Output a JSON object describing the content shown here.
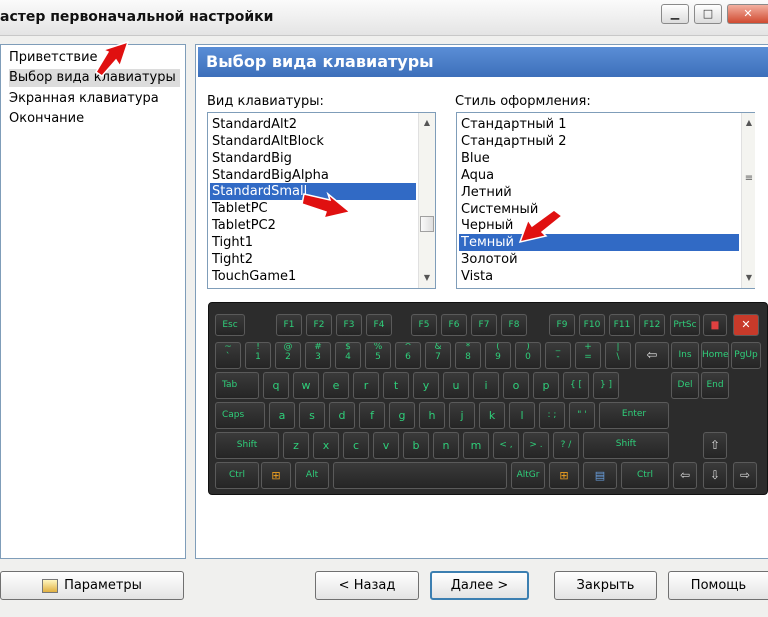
{
  "window": {
    "title": "астер первоначальной настройки",
    "buttons": {
      "minimize": "▁",
      "maximize": "□",
      "close": "✕"
    }
  },
  "nav": {
    "items": [
      {
        "label": "Приветствие"
      },
      {
        "label": "Выбор вида клавиатуры",
        "selected": true
      },
      {
        "label": "Экранная клавиатура"
      },
      {
        "label": "Окончание"
      }
    ]
  },
  "page": {
    "title": "Выбор вида клавиатуры",
    "keyboard_type": {
      "label": "Вид клавиатуры:",
      "items": [
        "StandardAlt2",
        "StandardAltBlock",
        "StandardBig",
        "StandardBigAlpha",
        "StandardSmall",
        "TabletPC",
        "TabletPC2",
        "Tight1",
        "Tight2",
        "TouchGame1"
      ],
      "selected": "StandardSmall"
    },
    "style": {
      "label": "Стиль оформления:",
      "items": [
        "Стандартный 1",
        "Стандартный 2",
        "Blue",
        "Aqua",
        "Летний",
        "Системный",
        "Черный",
        "Темный",
        "Золотой",
        "Vista"
      ],
      "selected": "Темный"
    }
  },
  "keyboard": {
    "row_fn": [
      "Esc",
      "F1",
      "F2",
      "F3",
      "F4",
      "F5",
      "F6",
      "F7",
      "F8",
      "F9",
      "F10",
      "F11",
      "F12",
      "PrtSc"
    ],
    "row_num": [
      [
        "~",
        "`"
      ],
      [
        "!",
        "1"
      ],
      [
        "@",
        "2"
      ],
      [
        "#",
        "3"
      ],
      [
        "$",
        "4"
      ],
      [
        "%",
        "5"
      ],
      [
        "^",
        "6"
      ],
      [
        "&",
        "7"
      ],
      [
        "*",
        "8"
      ],
      [
        "(",
        "9"
      ],
      [
        ")",
        "0"
      ],
      [
        "_",
        "-"
      ],
      [
        "+",
        "="
      ],
      [
        "|",
        "\\"
      ],
      [
        "",
        "⇦"
      ],
      [
        "",
        "Ins"
      ],
      [
        "",
        "Home"
      ],
      [
        "",
        "PgUp"
      ]
    ],
    "row_q": [
      "Tab",
      "q",
      "w",
      "e",
      "r",
      "t",
      "y",
      "u",
      "i",
      "o",
      "p",
      "{ [",
      "} ]",
      "Del",
      "End"
    ],
    "row_a": [
      "Caps",
      "a",
      "s",
      "d",
      "f",
      "g",
      "h",
      "j",
      "k",
      "l",
      ": ;",
      "\" '",
      "Enter"
    ],
    "row_z": [
      "Shift",
      "z",
      "x",
      "c",
      "v",
      "b",
      "n",
      "m",
      "< ,",
      "> .",
      "? /",
      "Shift",
      "⇧"
    ],
    "row_ctrl": [
      "Ctrl",
      "Alt",
      "AltGr",
      "Ctrl",
      "⇦",
      "⇩",
      "⇨"
    ],
    "accent": "#2fcf7a"
  },
  "footer": {
    "settings": "Параметры",
    "back": "< Назад",
    "next": "Далее >",
    "close": "Закрыть",
    "help": "Помощь"
  },
  "colors": {
    "selection": "#316ac5",
    "header": "#4a7fc9",
    "annotation_arrow": "#e01010"
  }
}
